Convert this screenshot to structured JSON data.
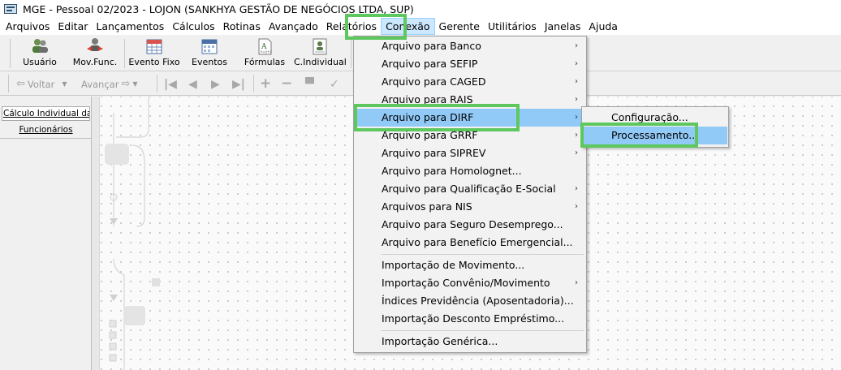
{
  "window": {
    "title": "MGE - Pessoal 02/2023 - LOJON (SANKHYA GESTÃO DE NEGÓCIOS LTDA, SUP)"
  },
  "menubar": {
    "items": [
      "Arquivos",
      "Editar",
      "Lançamentos",
      "Cálculos",
      "Rotinas",
      "Avançado",
      "Relatórios",
      "Conexão",
      "Gerente",
      "Utilitários",
      "Janelas",
      "Ajuda"
    ],
    "active": "Conexão"
  },
  "toolbar": {
    "buttons": [
      "Usuário",
      "Mov.Func.",
      "Evento Fixo",
      "Eventos",
      "Fórmulas",
      "C.Individual"
    ],
    "nav": {
      "back": "Voltar",
      "forward": "Avançar"
    }
  },
  "left_panel": {
    "tab1": "Cálculo Individual da ...",
    "tab2": "Funcionários"
  },
  "conexao_menu": {
    "items": [
      {
        "label": "Arquivo para Banco",
        "submenu": true
      },
      {
        "label": "Arquivo para SEFIP",
        "submenu": true
      },
      {
        "label": "Arquivo para CAGED",
        "submenu": true
      },
      {
        "label": "Arquivo para RAIS",
        "submenu": true
      },
      {
        "label": "Arquivo para DIRF",
        "submenu": true,
        "highlighted": true
      },
      {
        "label": "Arquivo para GRRF",
        "submenu": true
      },
      {
        "label": "Arquivo para SIPREV",
        "submenu": true
      },
      {
        "label": "Arquivo para Homolognet...",
        "submenu": false
      },
      {
        "label": "Arquivo para Qualificação E-Social",
        "submenu": true
      },
      {
        "label": "Arquivos para NIS",
        "submenu": true
      },
      {
        "label": "Arquivo para Seguro Desemprego...",
        "submenu": false
      },
      {
        "label": "Arquivo para Benefício Emergencial...",
        "submenu": false
      },
      {
        "label": "Importação de Movimento...",
        "submenu": false
      },
      {
        "label": "Importação Convênio/Movimento",
        "submenu": true
      },
      {
        "label": "Índices Previdência (Aposentadoria)...",
        "submenu": false
      },
      {
        "label": "Importação Desconto Empréstimo...",
        "submenu": false
      },
      {
        "label": "Importação Genérica...",
        "submenu": false
      }
    ]
  },
  "dirf_submenu": {
    "items": [
      {
        "label": "Configuração...",
        "highlighted": false
      },
      {
        "label": "Processamento...",
        "highlighted": true
      }
    ]
  },
  "colors": {
    "highlight": "#91c9f7",
    "annotation": "#5ec75e",
    "menu_active": "#cce8ff"
  }
}
